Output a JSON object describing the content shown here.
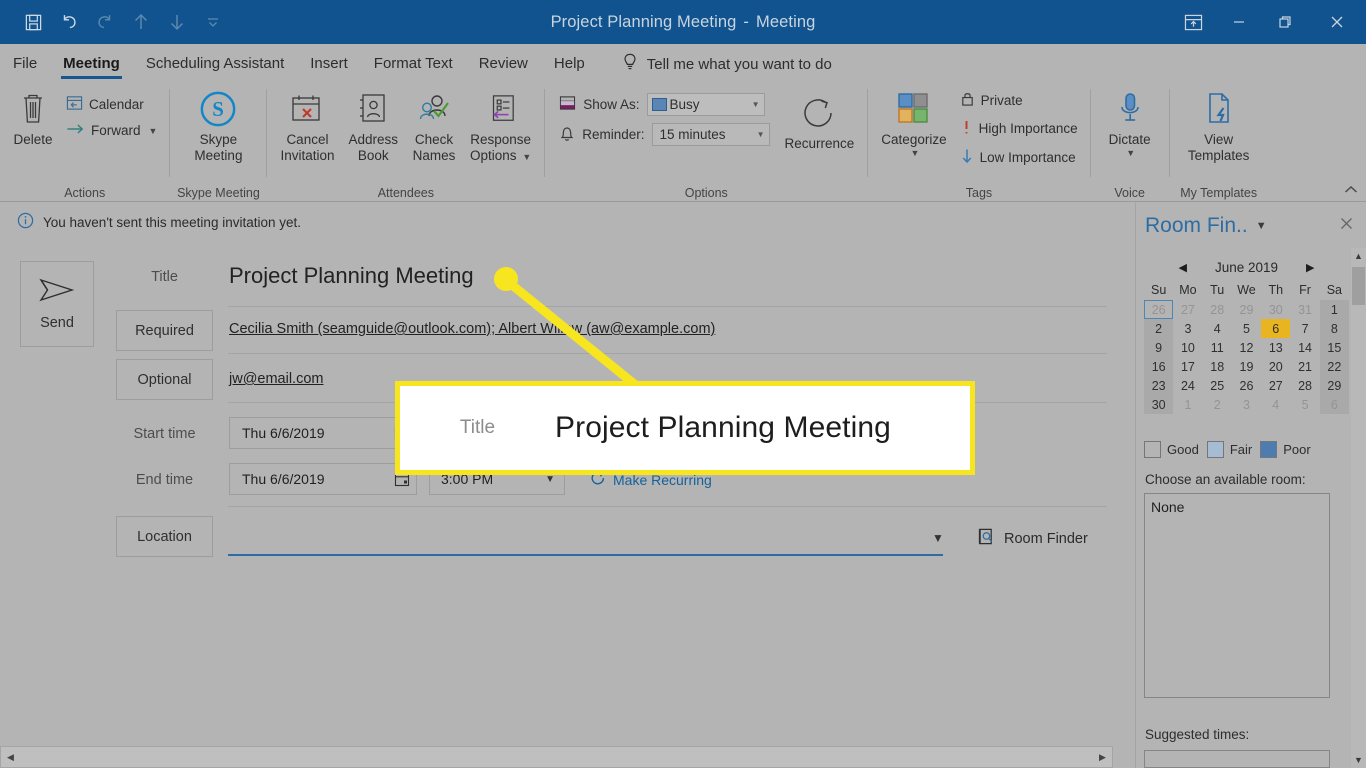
{
  "window": {
    "title": "Project Planning Meeting",
    "title_separator": "-",
    "title_suffix": "Meeting",
    "quick_access": [
      {
        "name": "save-icon",
        "label": "Save"
      },
      {
        "name": "undo-icon",
        "label": "Undo"
      },
      {
        "name": "redo-icon",
        "label": "Redo"
      },
      {
        "name": "up-arrow-icon",
        "label": "Previous Item"
      },
      {
        "name": "down-arrow-icon",
        "label": "Next Item"
      },
      {
        "name": "customize-quick-access-icon",
        "label": "Customize Quick Access Toolbar"
      }
    ],
    "controls": [
      {
        "name": "ribbon-display-options-icon",
        "label": "Ribbon Display Options"
      },
      {
        "name": "minimize-icon",
        "label": "Minimize"
      },
      {
        "name": "restore-icon",
        "label": "Restore Down"
      },
      {
        "name": "close-icon",
        "label": "Close"
      }
    ]
  },
  "tabs": [
    {
      "label": "File",
      "active": false
    },
    {
      "label": "Meeting",
      "active": true
    },
    {
      "label": "Scheduling Assistant",
      "active": false
    },
    {
      "label": "Insert",
      "active": false
    },
    {
      "label": "Format Text",
      "active": false
    },
    {
      "label": "Review",
      "active": false
    },
    {
      "label": "Help",
      "active": false
    }
  ],
  "tell_me": {
    "placeholder": "Tell me what you want to do",
    "icon": "lightbulb-icon"
  },
  "ribbon": {
    "groups": [
      {
        "name": "Actions",
        "label": "Actions",
        "delete_label": "Delete",
        "calendar_label": "Calendar",
        "forward_label": "Forward"
      },
      {
        "name": "Skype Meeting",
        "label": "Skype Meeting",
        "button_line1": "Skype",
        "button_line2": "Meeting"
      },
      {
        "name": "Attendees",
        "label": "Attendees",
        "buttons": [
          {
            "line1": "Cancel",
            "line2": "Invitation"
          },
          {
            "line1": "Address",
            "line2": "Book"
          },
          {
            "line1": "Check",
            "line2": "Names"
          },
          {
            "line1": "Response",
            "line2": "Options"
          }
        ]
      },
      {
        "name": "Options",
        "label": "Options",
        "show_as_label": "Show As:",
        "show_as_value": "Busy",
        "reminder_label": "Reminder:",
        "reminder_value": "15 minutes",
        "recurrence_label": "Recurrence"
      },
      {
        "name": "Tags",
        "label": "Tags",
        "categorize_label": "Categorize",
        "private_label": "Private",
        "high_importance_label": "High Importance",
        "low_importance_label": "Low Importance"
      },
      {
        "name": "Voice",
        "label": "Voice",
        "dictate_label": "Dictate"
      },
      {
        "name": "My Templates",
        "label": "My Templates",
        "view_templates_line1": "View",
        "view_templates_line2": "Templates"
      }
    ],
    "collapse_icon": "chevron-up-icon"
  },
  "infobar": {
    "icon": "info-icon",
    "message": "You haven't sent this meeting invitation yet."
  },
  "form": {
    "send_label": "Send",
    "title_label": "Title",
    "title_value": "Project Planning Meeting",
    "required_label": "Required",
    "required_value": "Cecilia Smith (seamguide@outlook.com); Albert Willow (aw@example.com)",
    "optional_label": "Optional",
    "optional_value": "jw@email.com",
    "start_time_label": "Start time",
    "start_date_value": "Thu 6/6/2019",
    "end_time_label": "End time",
    "end_date_value": "Thu 6/6/2019",
    "end_time_value": "3:00 PM",
    "make_recurring_label": "Make Recurring",
    "location_label": "Location",
    "location_value": "",
    "room_finder_label": "Room Finder"
  },
  "room_finder": {
    "title": "Room Fin..",
    "calendar": {
      "month": "June 2019",
      "prev_icon": "chevron-left-icon",
      "next_icon": "chevron-right-icon",
      "day_headers": [
        "Su",
        "Mo",
        "Tu",
        "We",
        "Th",
        "Fr",
        "Sa"
      ],
      "weeks": [
        [
          {
            "d": "26",
            "out": true,
            "sel": true
          },
          {
            "d": "27",
            "out": true
          },
          {
            "d": "28",
            "out": true
          },
          {
            "d": "29",
            "out": true
          },
          {
            "d": "30",
            "out": true
          },
          {
            "d": "31",
            "out": true
          },
          {
            "d": "1",
            "we": true
          }
        ],
        [
          {
            "d": "2",
            "we": true
          },
          {
            "d": "3"
          },
          {
            "d": "4"
          },
          {
            "d": "5"
          },
          {
            "d": "6",
            "today": true
          },
          {
            "d": "7"
          },
          {
            "d": "8",
            "we": true
          }
        ],
        [
          {
            "d": "9",
            "we": true
          },
          {
            "d": "10"
          },
          {
            "d": "11"
          },
          {
            "d": "12"
          },
          {
            "d": "13"
          },
          {
            "d": "14"
          },
          {
            "d": "15",
            "we": true
          }
        ],
        [
          {
            "d": "16",
            "we": true
          },
          {
            "d": "17"
          },
          {
            "d": "18"
          },
          {
            "d": "19"
          },
          {
            "d": "20"
          },
          {
            "d": "21"
          },
          {
            "d": "22",
            "we": true
          }
        ],
        [
          {
            "d": "23",
            "we": true
          },
          {
            "d": "24"
          },
          {
            "d": "25"
          },
          {
            "d": "26"
          },
          {
            "d": "27"
          },
          {
            "d": "28"
          },
          {
            "d": "29",
            "we": true
          }
        ],
        [
          {
            "d": "30",
            "we": true
          },
          {
            "d": "1",
            "out": true
          },
          {
            "d": "2",
            "out": true
          },
          {
            "d": "3",
            "out": true
          },
          {
            "d": "4",
            "out": true
          },
          {
            "d": "5",
            "out": true
          },
          {
            "d": "6",
            "out": true,
            "we": true
          }
        ]
      ]
    },
    "legend": [
      {
        "label": "Good",
        "color": "#b4b4b4"
      },
      {
        "label": "Fair",
        "color": "#a5bcd4"
      },
      {
        "label": "Poor",
        "color": "#4c7cb0"
      }
    ],
    "choose_room_label": "Choose an available room:",
    "room_list": [
      "None"
    ],
    "suggested_times_label": "Suggested times:"
  },
  "callout": {
    "label": "Title",
    "value": "Project Planning Meeting",
    "highlight_color": "#f7e520"
  },
  "colors": {
    "titlebar": "#10538f",
    "ribbon": "#b4b4b4",
    "accent": "#17568f",
    "link": "#16619c",
    "today": "#e8b520"
  }
}
